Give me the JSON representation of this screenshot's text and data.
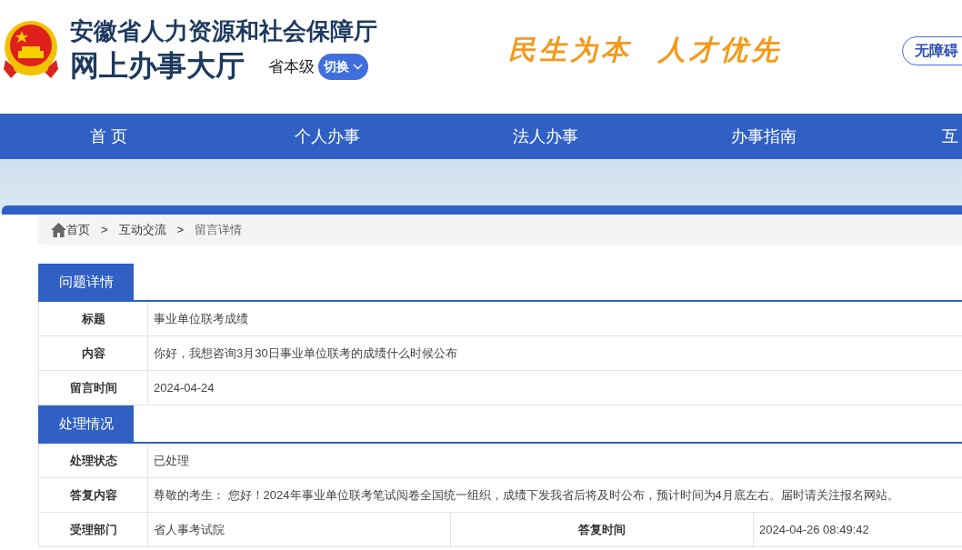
{
  "header": {
    "title": "安徽省人力资源和社会保障厅",
    "subtitle": "网上办事大厅",
    "level_label": "省本级",
    "switch_button": "切换",
    "slogan": "民生为本  人才优先",
    "accessibility_button": "无障碍"
  },
  "nav": [
    {
      "label": "首 页"
    },
    {
      "label": "个人办事"
    },
    {
      "label": "法人办事"
    },
    {
      "label": "办事指南"
    },
    {
      "label": "互"
    }
  ],
  "breadcrumb": {
    "separator": ">",
    "items": [
      "首页",
      "互动交流",
      "留言详情"
    ]
  },
  "sections": [
    {
      "title": "问题详情",
      "rows": [
        [
          {
            "kind": "label",
            "text": "标题"
          },
          {
            "kind": "value",
            "text": "事业单位联考成绩"
          }
        ],
        [
          {
            "kind": "label",
            "text": "内容"
          },
          {
            "kind": "value",
            "text": "你好，我想咨询3月30日事业单位联考的成绩什么时候公布"
          }
        ],
        [
          {
            "kind": "label",
            "text": "留言时间"
          },
          {
            "kind": "value",
            "text": "2024-04-24"
          }
        ]
      ]
    },
    {
      "title": "处理情况",
      "rows": [
        [
          {
            "kind": "label",
            "text": "处理状态"
          },
          {
            "kind": "value",
            "text": "已处理"
          }
        ],
        [
          {
            "kind": "label",
            "text": "答复内容"
          },
          {
            "kind": "value",
            "text": "尊敬的考生： 您好！2024年事业单位联考笔试阅卷全国统一组织，成绩下发我省后将及时公布，预计时间为4月底左右。届时请关注报名网站。"
          }
        ],
        [
          {
            "kind": "label",
            "text": "受理部门"
          },
          {
            "kind": "value",
            "text": "省人事考试院"
          },
          {
            "kind": "label",
            "text": "答复时间"
          },
          {
            "kind": "value",
            "text": "2024-04-26 08:49:42"
          }
        ]
      ]
    }
  ]
}
